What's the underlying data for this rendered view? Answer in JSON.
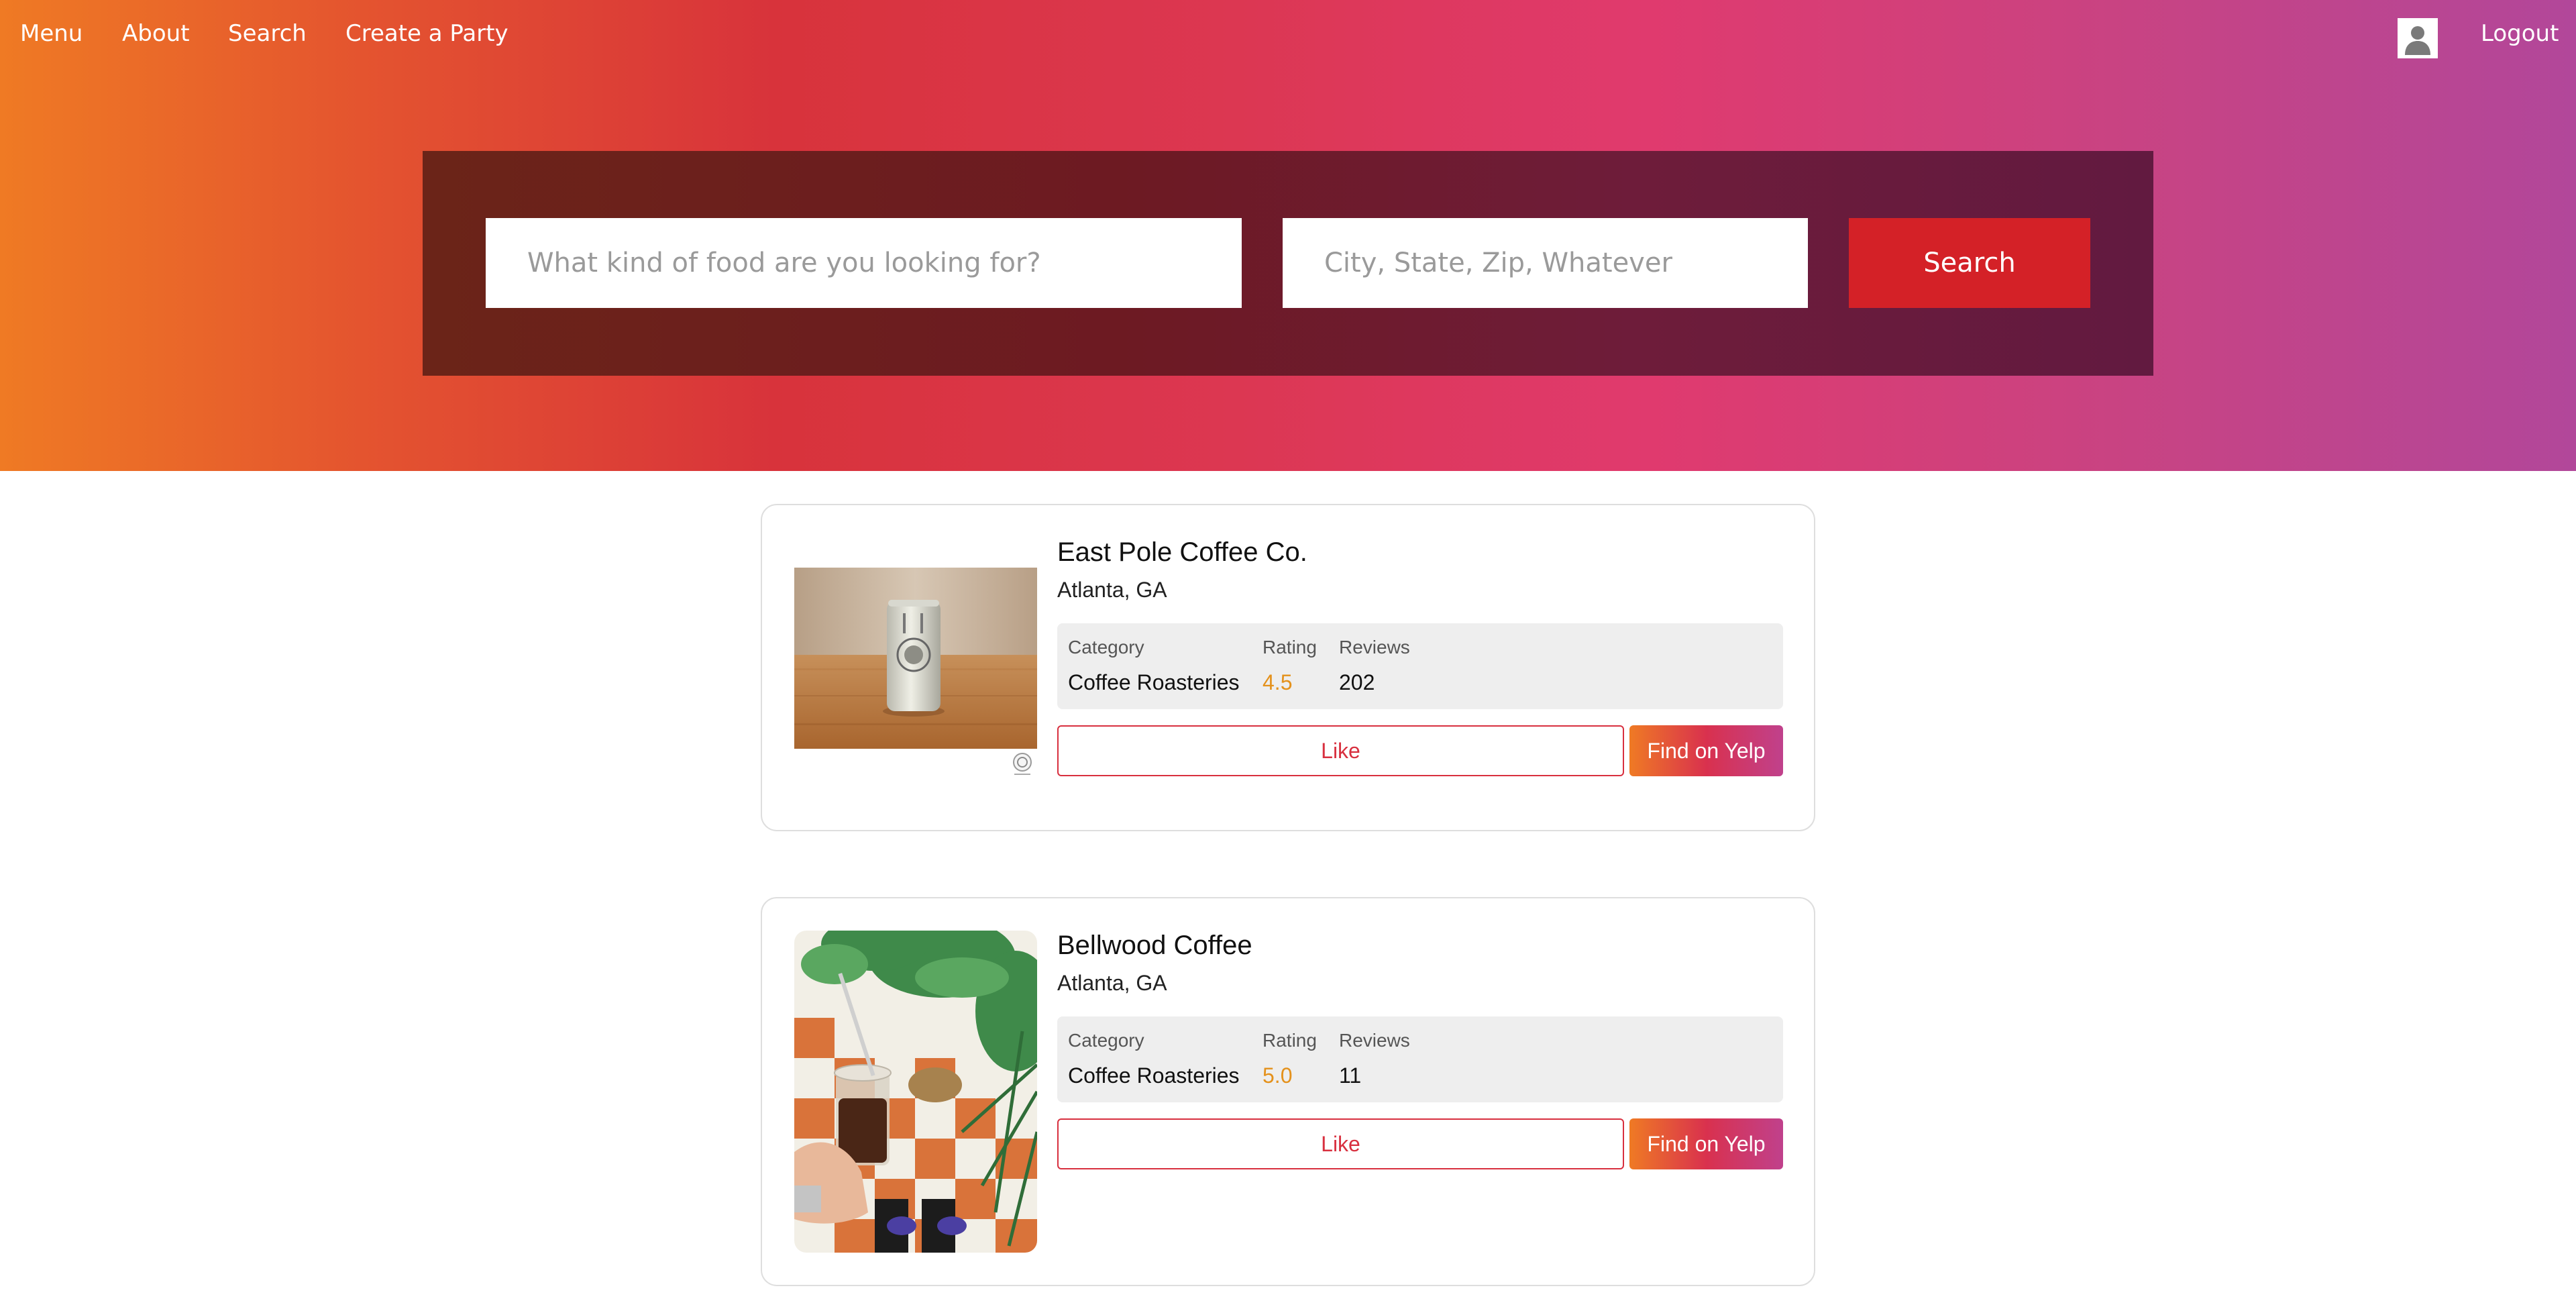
{
  "nav": {
    "menu": "Menu",
    "about": "About",
    "search": "Search",
    "create_party": "Create a Party",
    "logout": "Logout",
    "user_icon": "user-avatar-icon"
  },
  "search": {
    "food_placeholder": "What kind of food are you looking for?",
    "location_placeholder": "City, State, Zip, Whatever",
    "submit_label": "Search"
  },
  "labels": {
    "category": "Category",
    "rating": "Rating",
    "reviews": "Reviews",
    "like": "Like",
    "find_on_yelp": "Find on Yelp"
  },
  "results": [
    {
      "name": "East Pole Coffee Co.",
      "location": "Atlanta, GA",
      "category": "Coffee Roasteries",
      "rating": "4.5",
      "reviews": "202",
      "image": "coffee-can-photo"
    },
    {
      "name": "Bellwood Coffee",
      "location": "Atlanta, GA",
      "category": "Coffee Roasteries",
      "rating": "5.0",
      "reviews": "11",
      "image": "iced-coffee-photo"
    }
  ],
  "colors": {
    "accent_red": "#d42127",
    "rating_orange": "#e4911b",
    "gradient_start": "#ef7a24",
    "gradient_end": "#b2479a"
  }
}
